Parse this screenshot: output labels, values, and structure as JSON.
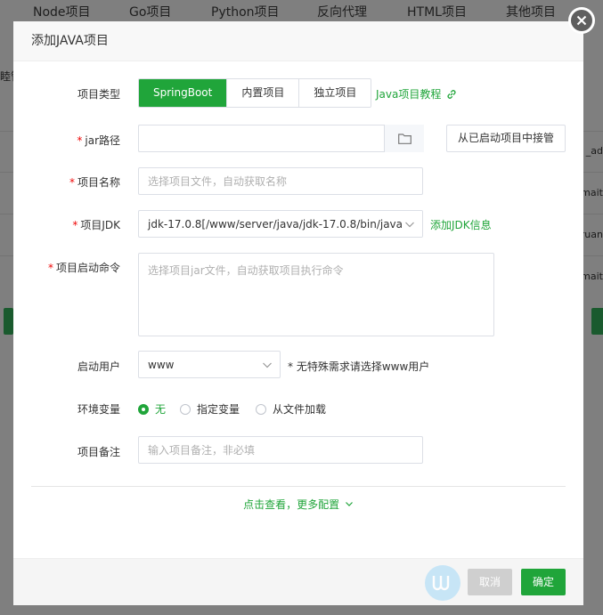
{
  "background": {
    "tabs": [
      "Node项目",
      "Go项目",
      "Python项目",
      "反向代理",
      "HTML项目",
      "其他项目"
    ],
    "sidebar_fragment": "睦管",
    "right_fragments": [
      "_ad",
      "mait",
      "ruan",
      "mait"
    ]
  },
  "dialog": {
    "title": "添加JAVA项目",
    "project_type": {
      "label": "项目类型",
      "options": [
        "SpringBoot",
        "内置项目",
        "独立项目"
      ],
      "selected": "SpringBoot",
      "tutorial_link": "Java项目教程"
    },
    "jar_path": {
      "label": "jar路径",
      "required_mark": "*",
      "value": "",
      "takeover_button": "从已启动项目中接管"
    },
    "project_name": {
      "label": "项目名称",
      "required_mark": "*",
      "placeholder": "选择项目文件，自动获取名称"
    },
    "project_jdk": {
      "label": "项目JDK",
      "required_mark": "*",
      "value": "jdk-17.0.8[/www/server/java/jdk-17.0.8/bin/java]",
      "add_link": "添加JDK信息"
    },
    "start_command": {
      "label": "项目启动命令",
      "required_mark": "*",
      "placeholder": "选择项目jar文件，自动获取项目执行命令"
    },
    "run_user": {
      "label": "启动用户",
      "value": "www",
      "hint": "* 无特殊需求请选择www用户"
    },
    "env_vars": {
      "label": "环境变量",
      "options": [
        "无",
        "指定变量",
        "从文件加载"
      ],
      "selected": "无"
    },
    "remark": {
      "label": "项目备注",
      "placeholder": "输入项目备注，非必填"
    },
    "more_config": "点击查看，更多配置",
    "cancel_button": "取消",
    "ok_button": "确定"
  },
  "colors": {
    "accent": "#20a53a",
    "required": "#ef0808"
  }
}
